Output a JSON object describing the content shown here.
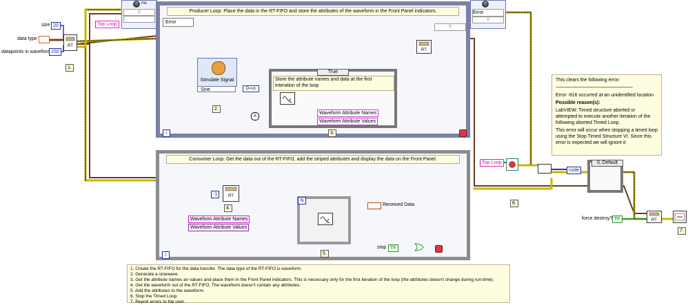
{
  "controls": {
    "size_label": "size",
    "size_value": "20",
    "data_type_label": "data type",
    "datapoints_label": "datapoints in waveform",
    "datapoints_value": "150"
  },
  "top_loop": {
    "label": "Top Loop",
    "timing_unit": "ms",
    "error_label": "Error"
  },
  "producer": {
    "title": "Producer Loop: Place the data in the RT-FIFO and store the attributes of the waveform in the Front Panel indicators.",
    "error_label": "Error",
    "simulate_signal": "Simulate Signal",
    "signal_type": "Sine",
    "case_selector": "True",
    "case_text": "Store the attribute names and data at the first interation of the loop",
    "attr_names_indicator": "Waveform Attribute Names",
    "attr_values_indicator": "Waveform Attribute Values",
    "iteration_terminal": "i",
    "first_call_glyph": "A"
  },
  "consumer": {
    "title": "Consumer Loop: Get the data out of the RT-FIFO, add the striped attributes and display the data on the Front Panel.",
    "timeout_value": "-1",
    "rt_label": "RT",
    "for_loop_count": "N",
    "attr_names_local": "Waveform Attribute Names",
    "attr_values_local": "Waveform Attribute Values",
    "received_data": "Received Data",
    "stop_label": "stop",
    "stop_value": "TF",
    "iteration_terminal": "i"
  },
  "error_handling": {
    "top_loop_ref": "Top Loop",
    "code_label": "code",
    "case_selector": "0, Default",
    "force_destroy": "force destroy?",
    "force_destroy_value": "TF"
  },
  "steps": [
    "1.",
    "2.",
    "3.",
    "4.",
    "5.",
    "6.",
    "7."
  ],
  "note": {
    "line1": "This clears the following error:",
    "separator": "-------------------------------------------------------------",
    "line2": "Error -816 occurred at an unidentified location",
    "reasons_title": "Possible reason(s):",
    "reason": "LabVIEW:  Timed structure aborted or attempted to execute another iteration of the following aborted Timed Loop.",
    "line3": "This error will occur when stopping  a timed loop using the Stop Timed Structure VI.  Since this error is expected we will ignore it"
  },
  "instructions": [
    "1. Create the RT-FIFO for the data transfer. The data type of the RT-FIFO is waveform.",
    "2. Generate a sinewave.",
    "3. Get the attribute names an values and place them in the Front Panel indicators. This is necessary only for the first iteration of the loop (the attributes doesn't change during run-time).",
    "4. Get the waveform out of the RT-FIFO. The waveform doesn't contain any attributes.",
    "5. Add the attributes to the waveform.",
    "6. Stop the Timed Loop.",
    "7. Report errors to the user."
  ],
  "colors": {
    "waveform_wire": "#8b3a14",
    "error_wire": "#c8b400",
    "string_wire": "#d61ad6",
    "numeric_wire": "#2a3aa8",
    "boolean_wire": "#2e8b2e",
    "refnum_wire": "#3a8a7a",
    "note_bg": "#fffde0"
  }
}
